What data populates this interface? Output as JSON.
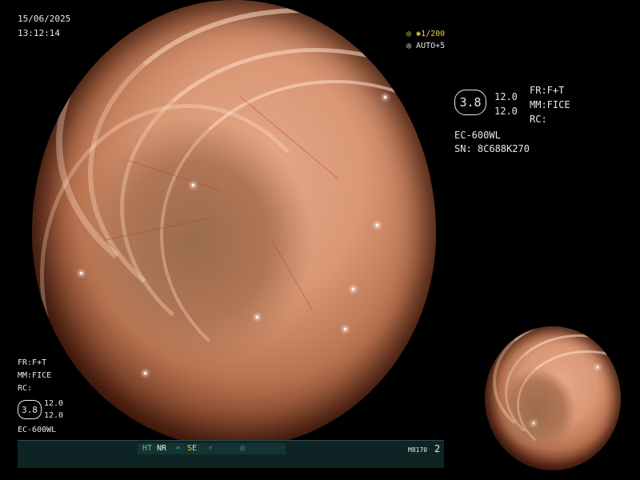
{
  "timestamp": {
    "date": "15/06/2025",
    "time": "13:12:14"
  },
  "exposure": {
    "shutter": "1/200",
    "auto": "AUTO+5"
  },
  "settings_panel": {
    "value_box": "3.8",
    "value_top": "12.0",
    "value_bottom": "12.0",
    "fr": "FR:F+T",
    "mm": "MM:FICE",
    "rc": "RC:",
    "model": "EC-600WL",
    "serial": "SN: 8C688K270"
  },
  "bottom_left_panel": {
    "fr": "FR:F+T",
    "mm": "MM:FICE",
    "rc": "RC:",
    "value_box": "3.8",
    "value_top": "12.0",
    "value_bottom": "12.0",
    "model": "EC-600WL"
  },
  "status_bar": {
    "ht": "HT",
    "nr": "NR",
    "se": "SE",
    "code": "M8170",
    "page": "2"
  },
  "colors": {
    "accent_yellow": "#e8d44a",
    "status_green": "#3fcf6f",
    "status_bar_bg": "#0e2424"
  }
}
